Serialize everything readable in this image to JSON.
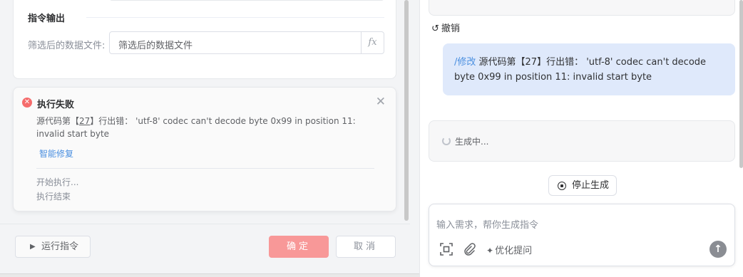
{
  "left": {
    "section_title": "指令输出",
    "output_field": {
      "label": "筛选后的数据文件:",
      "value": "筛选后的数据文件",
      "fx_label": "fx"
    },
    "error_card": {
      "title": "执行失败",
      "message_prefix": "源代码第【",
      "line_number": "27",
      "message_suffix": "】行出错： 'utf-8' codec can't decode byte 0x99 in position 11: invalid start byte",
      "fix_link": "智能修复",
      "logs": [
        "开始执行...",
        "执行结束"
      ]
    },
    "footer": {
      "run_label": "运行指令",
      "ok_label": "确定",
      "cancel_label": "取消"
    }
  },
  "right": {
    "undo_label": "撤销",
    "user_message": {
      "command": "/修改",
      "text": " 源代码第【27】行出错： 'utf-8' codec can't decode byte 0x99 in position 11: invalid start byte"
    },
    "generating_label": "生成中...",
    "stop_label": "停止生成",
    "input": {
      "placeholder": "输入需求，帮你生成指令",
      "value": ""
    },
    "optimize_label": "优化提问"
  },
  "colors": {
    "error": "#f56c6c",
    "link": "#4a8fe0",
    "ok_button": "#f89898",
    "user_bubble": "#dfe9fb"
  },
  "icons": [
    "error-circle-icon",
    "close-icon",
    "play-icon",
    "undo-icon",
    "spinner-icon",
    "stop-circle-icon",
    "screenshot-icon",
    "paperclip-icon",
    "sparkle-icon",
    "send-arrow-icon"
  ]
}
